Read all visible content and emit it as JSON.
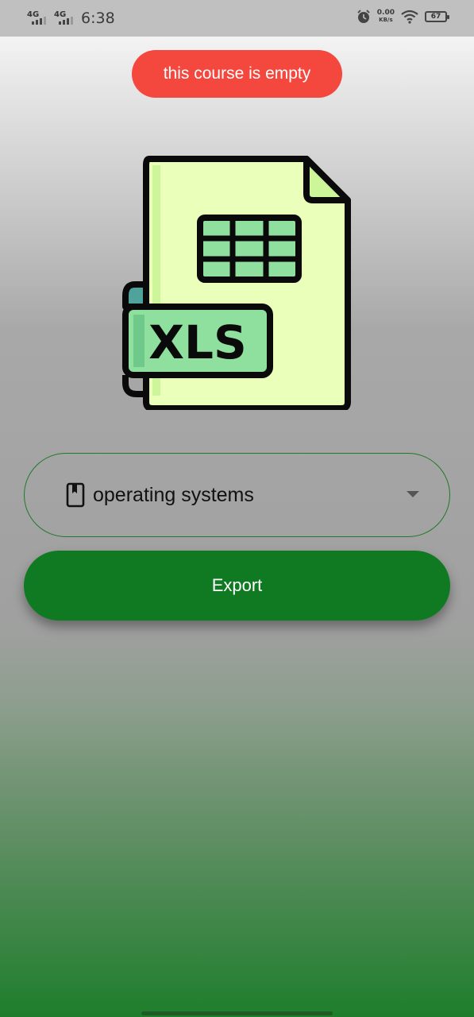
{
  "status_bar": {
    "network_1": "4G",
    "network_2": "4G",
    "time": "6:38",
    "speed_value": "0.00",
    "speed_unit": "KB/s",
    "battery": "67",
    "icons": [
      "signal-icon",
      "alarm-icon",
      "wifi-icon",
      "battery-icon"
    ]
  },
  "toast": {
    "message": "this course is empty",
    "color": "#f4473d"
  },
  "illustration": {
    "label": "XLS",
    "icon": "xls-file-icon"
  },
  "course_select": {
    "selected": "operating systems",
    "icon": "book-icon",
    "accent": "#1f7a2a"
  },
  "export_button": {
    "label": "Export",
    "color": "#0f7a22"
  }
}
